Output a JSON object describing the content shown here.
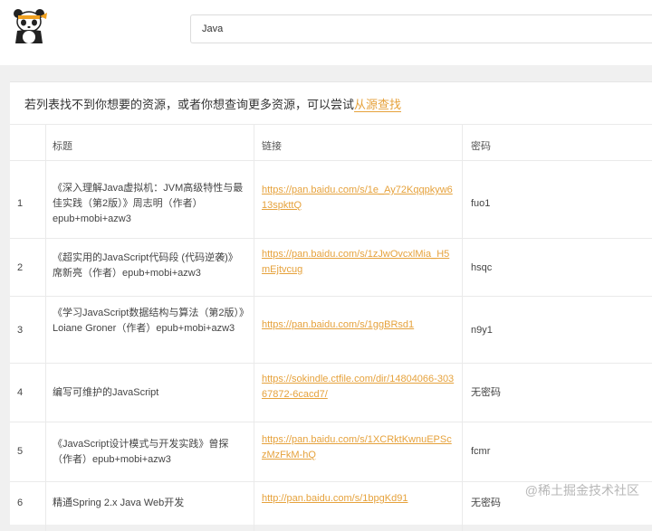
{
  "search": {
    "value": "Java"
  },
  "notice": {
    "text": "若列表找不到你想要的资源，或者你想查询更多资源，可以尝试",
    "link": "从源查找"
  },
  "table": {
    "headers": [
      "标题",
      "链接",
      "密码"
    ],
    "rows": [
      {
        "index": "1",
        "title": "《深入理解Java虚拟机：JVM高级特性与最佳实践（第2版）》周志明（作者）epub+mobi+azw3",
        "url": "https://pan.baidu.com/s/1e_Ay72Kqqpkyw613spkttQ",
        "password": "fuo1"
      },
      {
        "index": "2",
        "title": "《超实用的JavaScript代码段 (代码逆袭)》席新亮（作者）epub+mobi+azw3",
        "url": "https://pan.baidu.com/s/1zJwOvcxlMia_H5mEjtvcug",
        "password": "hsqc"
      },
      {
        "index": "3",
        "title": "《学习JavaScript数据结构与算法（第2版）》Loiane Groner（作者）epub+mobi+azw3",
        "url": "https://pan.baidu.com/s/1ggBRsd1",
        "password": "n9y1"
      },
      {
        "index": "4",
        "title": "编写可维护的JavaScript",
        "url": "https://sokindle.ctfile.com/dir/14804066-30367872-6cacd7/",
        "password": "无密码"
      },
      {
        "index": "5",
        "title": "《JavaScript设计模式与开发实践》曾探（作者）epub+mobi+azw3",
        "url": "https://pan.baidu.com/s/1XCRktKwnuEPSczMzFkM-hQ",
        "password": "fcmr"
      },
      {
        "index": "6",
        "title": "精通Spring 2.x Java Web开发",
        "url": "http://pan.baidu.com/s/1bpgKd91",
        "password": "无密码"
      }
    ]
  },
  "watermark": "@稀土掘金技术社区"
}
